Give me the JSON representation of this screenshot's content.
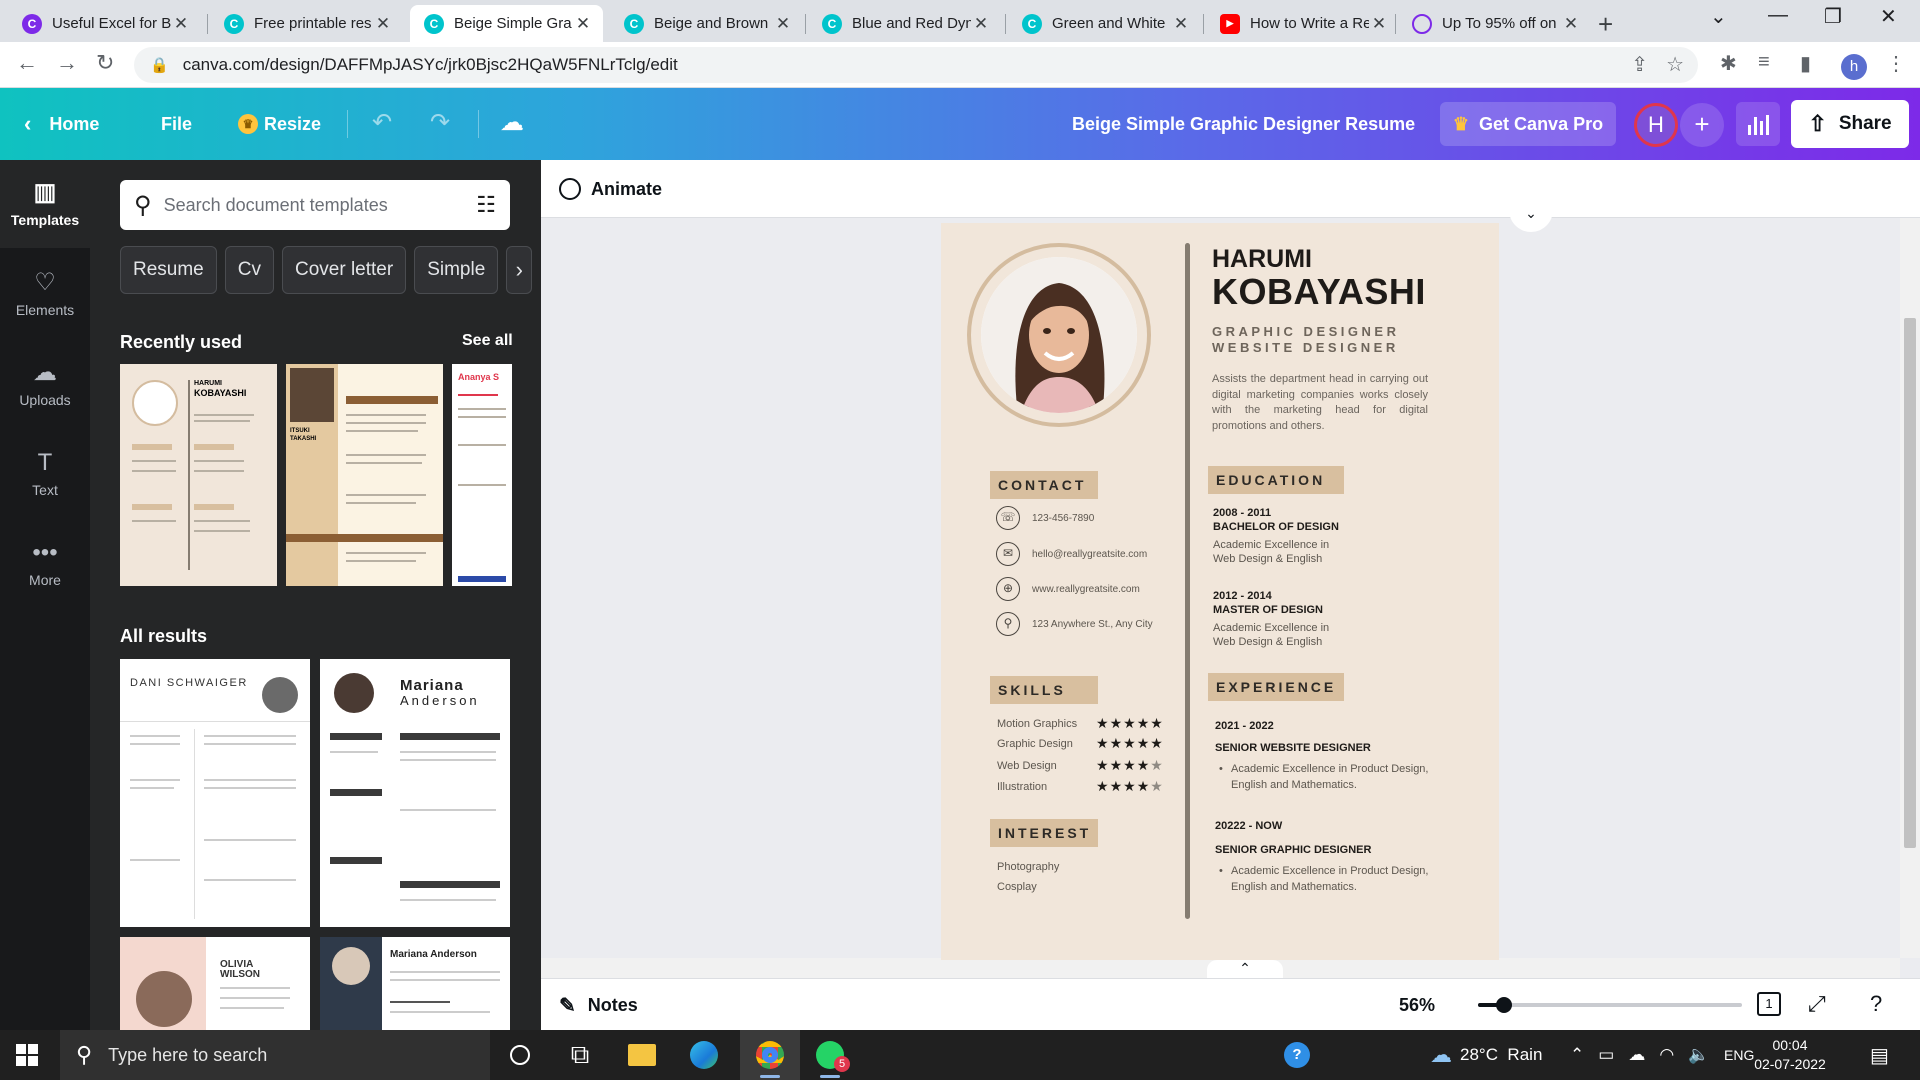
{
  "browser": {
    "tabs": [
      {
        "title": "Useful Excel for Be",
        "favicon": "canva-icon",
        "fav_color": "#7d2ae8",
        "active": false
      },
      {
        "title": "Free printable res",
        "favicon": "canva-icon",
        "fav_color": "#00c4cc",
        "active": false
      },
      {
        "title": "Beige Simple Gra",
        "favicon": "canva-icon",
        "fav_color": "#00c4cc",
        "active": true
      },
      {
        "title": "Beige and Brown",
        "favicon": "canva-icon",
        "fav_color": "#00c4cc",
        "active": false
      },
      {
        "title": "Blue and Red Dyn",
        "favicon": "canva-icon",
        "fav_color": "#00c4cc",
        "active": false
      },
      {
        "title": "Green and White",
        "favicon": "canva-icon",
        "fav_color": "#00c4cc",
        "active": false
      },
      {
        "title": "How to Write a Re",
        "favicon": "youtube-icon",
        "fav_color": "#ff0000",
        "active": false
      },
      {
        "title": "Up To 95% off on",
        "favicon": "loading-icon",
        "fav_color": "#7d2ae8",
        "active": false
      }
    ],
    "url": "canva.com/design/DAFFMpJASYc/jrk0Bjsc2HQaW5FNLrTclg/edit",
    "profile_initial": "h"
  },
  "header": {
    "home_label": "Home",
    "file_label": "File",
    "resize_label": "Resize",
    "design_title": "Beige Simple Graphic Designer Resume",
    "pro_label": "Get Canva Pro",
    "avatar_initial": "H",
    "share_label": "Share"
  },
  "rail": [
    {
      "label": "Templates",
      "icon": "templates-icon",
      "active": true
    },
    {
      "label": "Elements",
      "icon": "elements-icon",
      "active": false
    },
    {
      "label": "Uploads",
      "icon": "uploads-icon",
      "active": false
    },
    {
      "label": "Text",
      "icon": "text-icon",
      "active": false
    },
    {
      "label": "More",
      "icon": "more-icon",
      "active": false
    }
  ],
  "panel": {
    "search_placeholder": "Search document templates",
    "chips": [
      "Resume",
      "Cv",
      "Cover letter",
      "Simple"
    ],
    "recently_used_title": "Recently used",
    "see_all": "See all",
    "all_results_title": "All results",
    "recent_thumbs": [
      {
        "lines": [
          "HARUMI",
          "KOBAYASHI"
        ]
      },
      {
        "lines": [
          "ITSUKI",
          "TAKASHI"
        ]
      },
      {
        "lines": [
          "Ananya S"
        ]
      }
    ],
    "result_thumbs": [
      {
        "lines": [
          "DANI SCHWAIGER"
        ]
      },
      {
        "lines": [
          "Mariana",
          "Anderson"
        ]
      },
      {
        "lines": [
          "OLIVIA",
          "WILSON"
        ]
      },
      {
        "lines": [
          "Mariana Anderson"
        ]
      }
    ]
  },
  "canvas": {
    "animate_label": "Animate",
    "notes_label": "Notes",
    "zoom_label": "56%",
    "zoom_fraction": 0.1,
    "page_count": "1"
  },
  "resume": {
    "first_name": "HARUMI",
    "last_name": "KOBAYASHI",
    "role1": "GRAPHIC DESIGNER",
    "role2": "WEBSITE DESIGNER",
    "summary": "Assists the department head in carrying out digital marketing companies works closely with the marketing head for digital promotions and others.",
    "contact_title": "CONTACT",
    "contacts": [
      {
        "icon": "phone-icon",
        "text": "123-456-7890"
      },
      {
        "icon": "mail-icon",
        "text": "hello@reallygreatsite.com"
      },
      {
        "icon": "globe-icon",
        "text": "www.reallygreatsite.com"
      },
      {
        "icon": "location-icon",
        "text": "123 Anywhere St., Any City"
      }
    ],
    "skills_title": "SKILLS",
    "skills": [
      {
        "name": "Motion Graphics",
        "rating": 5
      },
      {
        "name": "Graphic Design",
        "rating": 5
      },
      {
        "name": "Web Design",
        "rating": 4
      },
      {
        "name": "Illustration",
        "rating": 4
      }
    ],
    "interest_title": "INTEREST",
    "interests": [
      "Photography",
      "Cosplay"
    ],
    "education_title": "EDUCATION",
    "education": [
      {
        "years": "2008 - 2011",
        "degree": "BACHELOR OF DESIGN",
        "detail": "Academic Excellence in Web Design & English"
      },
      {
        "years": "2012 - 2014",
        "degree": "MASTER OF DESIGN",
        "detail": "Academic Excellence in Web Design & English"
      }
    ],
    "experience_title": "EXPERIENCE",
    "experience": [
      {
        "years": "2021 - 2022",
        "title": "SENIOR WEBSITE DESIGNER",
        "detail": "Academic Excellence in Product Design, English and Mathematics."
      },
      {
        "years": "20222 - NOW",
        "title": "SENIOR GRAPHIC DESIGNER",
        "detail": "Academic Excellence in Product Design, English and Mathematics."
      }
    ]
  },
  "taskbar": {
    "search_placeholder": "Type here to search",
    "weather": "28°C  Rain",
    "lang": "ENG",
    "time": "00:04",
    "date": "02-07-2022",
    "whatsapp_badge": "5"
  }
}
